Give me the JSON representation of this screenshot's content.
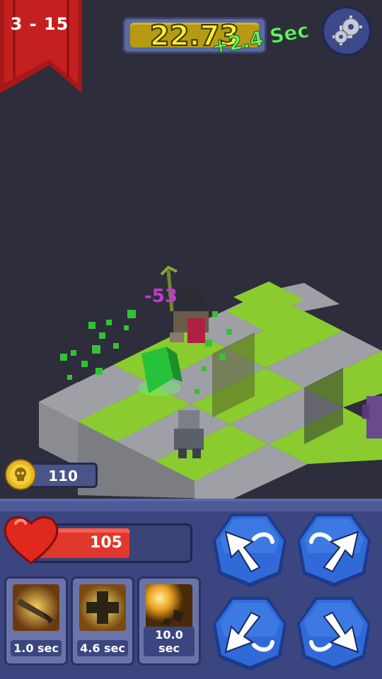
{
  "level": {
    "label": "3 - 15"
  },
  "timer": {
    "value": "22.73",
    "bonus": "+2.4 Sec"
  },
  "combat": {
    "damage": "-53"
  },
  "coins": {
    "value": "110",
    "icon": "skull-coin-icon"
  },
  "player": {
    "hp": "105",
    "hp_fraction": 0.62,
    "icon": "heart-icon"
  },
  "skills": [
    {
      "name": "blade-skill",
      "label": "1.0 sec"
    },
    {
      "name": "heal-skill",
      "label": "4.6 sec"
    },
    {
      "name": "blast-skill",
      "label": "10.0 sec"
    }
  ],
  "move_buttons": [
    {
      "name": "move-up-left-button",
      "icon": "arrow-up-left-icon"
    },
    {
      "name": "move-up-right-button",
      "icon": "arrow-up-right-icon"
    },
    {
      "name": "move-down-left-button",
      "icon": "arrow-down-left-icon"
    },
    {
      "name": "move-down-right-button",
      "icon": "arrow-down-right-icon"
    }
  ],
  "colors": {
    "grass": "#8acb2f",
    "stone": "#9ea0a6",
    "hud": "#3b4680",
    "hp": "#e0382c",
    "timer": "#f6ef2a"
  }
}
